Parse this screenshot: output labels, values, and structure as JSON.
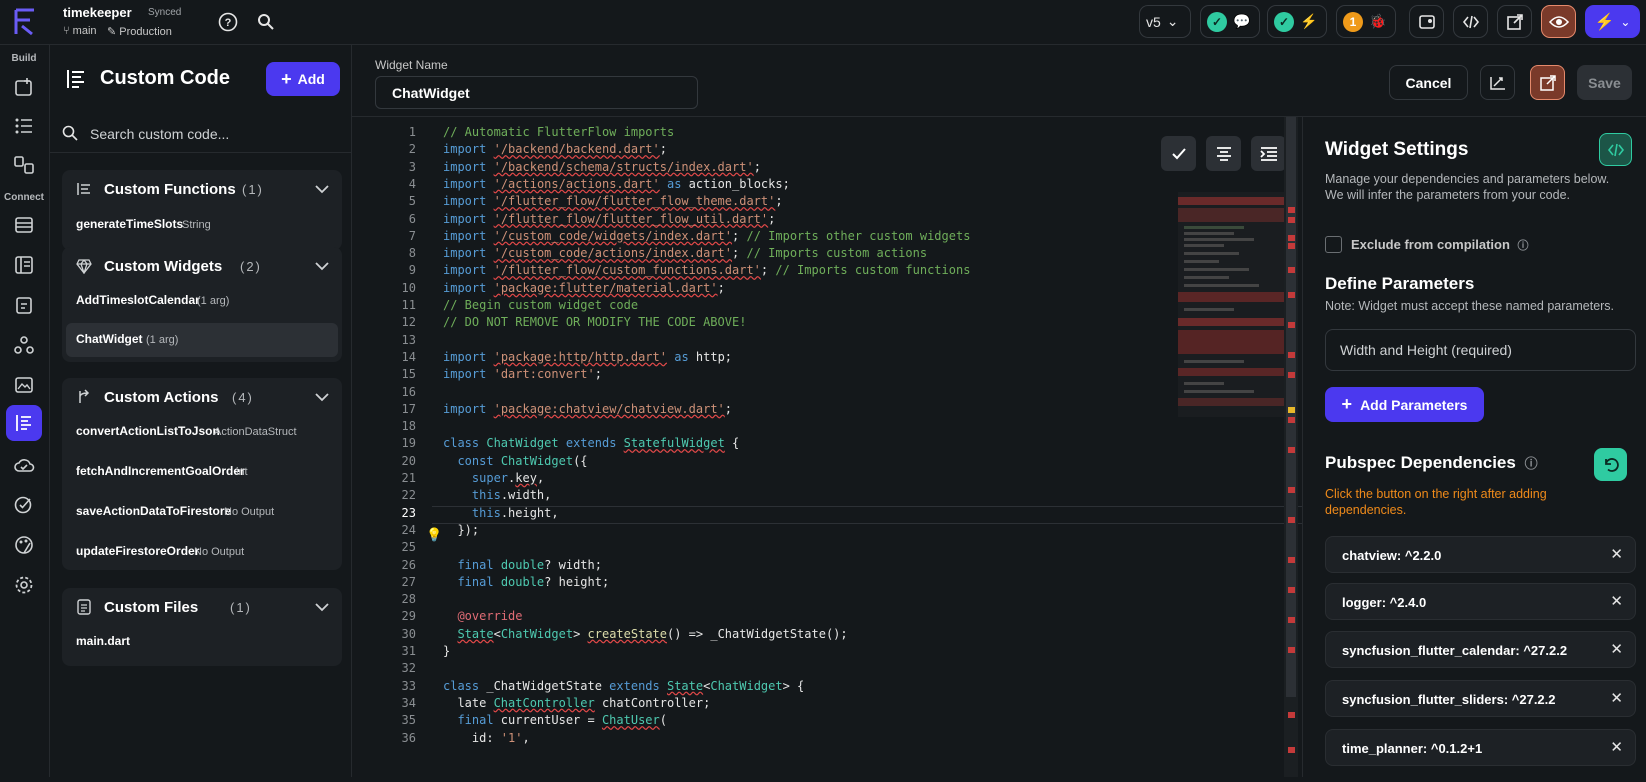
{
  "topbar": {
    "app_name": "timekeeper",
    "sync_state": "Synced",
    "branch": "main",
    "environment": "Production",
    "version": "v5",
    "issues_count": "1"
  },
  "rail": {
    "build_label": "Build",
    "connect_label": "Connect"
  },
  "panel": {
    "title": "Custom Code",
    "add_label": "Add",
    "search_placeholder": "Search custom code...",
    "groups": [
      {
        "title": "Custom Functions",
        "count": "(1)",
        "items": [
          {
            "name": "generateTimeSlots",
            "type": "String"
          }
        ]
      },
      {
        "title": "Custom Widgets",
        "count": "(2)",
        "items": [
          {
            "name": "AddTimeslotCalendar",
            "type": "(1 arg)"
          },
          {
            "name": "ChatWidget",
            "type": "(1 arg)"
          }
        ]
      },
      {
        "title": "Custom Actions",
        "count": "(4)",
        "items": [
          {
            "name": "convertActionListToJson",
            "type": "ActionDataStruct"
          },
          {
            "name": "fetchAndIncrementGoalOrder",
            "type": "int"
          },
          {
            "name": "saveActionDataToFirestore",
            "type": "No Output"
          },
          {
            "name": "updateFirestoreOrder",
            "type": "No Output"
          }
        ]
      },
      {
        "title": "Custom Files",
        "count": "(1)",
        "items": [
          {
            "name": "main.dart",
            "type": ""
          }
        ]
      }
    ]
  },
  "editor": {
    "widget_name_label": "Widget Name",
    "widget_name_value": "ChatWidget",
    "cancel_label": "Cancel",
    "save_label": "Save",
    "current_line": "23",
    "lines": [
      "1",
      "2",
      "3",
      "4",
      "5",
      "6",
      "7",
      "8",
      "9",
      "10",
      "11",
      "12",
      "13",
      "14",
      "15",
      "16",
      "17",
      "18",
      "19",
      "20",
      "21",
      "22",
      "23",
      "24",
      "25",
      "26",
      "27",
      "28",
      "29",
      "30",
      "31",
      "32",
      "33",
      "34",
      "35",
      "36"
    ]
  },
  "settings": {
    "title": "Widget Settings",
    "desc1": "Manage your dependencies and parameters below.",
    "desc2": "We will infer the parameters from your code.",
    "exclude_label": "Exclude from compilation",
    "params_title": "Define Parameters",
    "params_note": "Note: Widget must accept these named parameters.",
    "param_field": "Width and Height (required)",
    "add_params_label": "Add Parameters",
    "deps_title": "Pubspec Dependencies",
    "deps_warning": "Click the button on the right after adding dependencies.",
    "dependencies": [
      "chatview: ^2.2.0",
      "logger: ^2.4.0",
      "syncfusion_flutter_calendar: ^27.2.2",
      "syncfusion_flutter_sliders: ^27.2.2",
      "time_planner: ^0.1.2+1"
    ]
  },
  "colors": {
    "accent": "#4b39ef",
    "success": "#2fcba1",
    "warning": "#ef8a1a",
    "background": "#14181b"
  }
}
